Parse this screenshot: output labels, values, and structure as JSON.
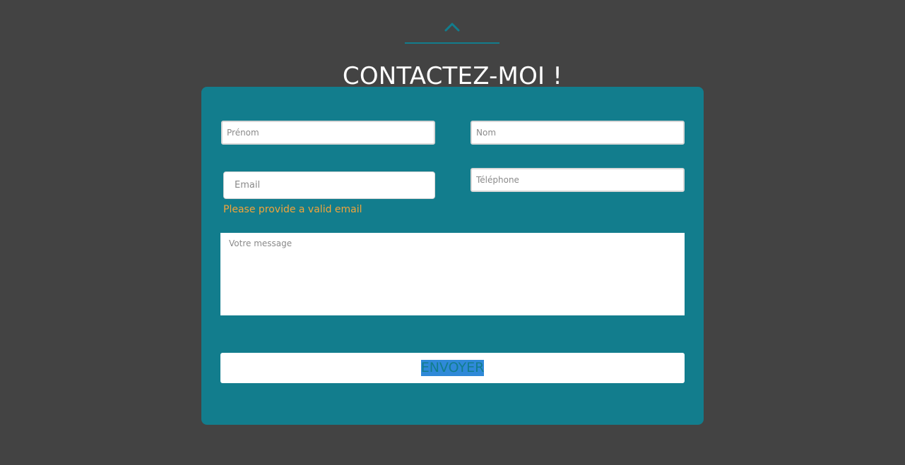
{
  "header": {
    "scroll_up_icon": "chevron-up-icon",
    "title": "CONTACTEZ-MOI !"
  },
  "form": {
    "prenom": {
      "placeholder": "Prénom",
      "value": ""
    },
    "nom": {
      "placeholder": "Nom",
      "value": ""
    },
    "email": {
      "placeholder": "Email",
      "value": "",
      "error": "Please provide a valid email"
    },
    "telephone": {
      "placeholder": "Téléphone",
      "value": ""
    },
    "message": {
      "placeholder": "Votre message",
      "value": ""
    },
    "submit_label": "ENVOYER"
  },
  "colors": {
    "background": "#434343",
    "card": "#127d8d",
    "error": "#f2a43a",
    "selection": "#2f89d8"
  }
}
